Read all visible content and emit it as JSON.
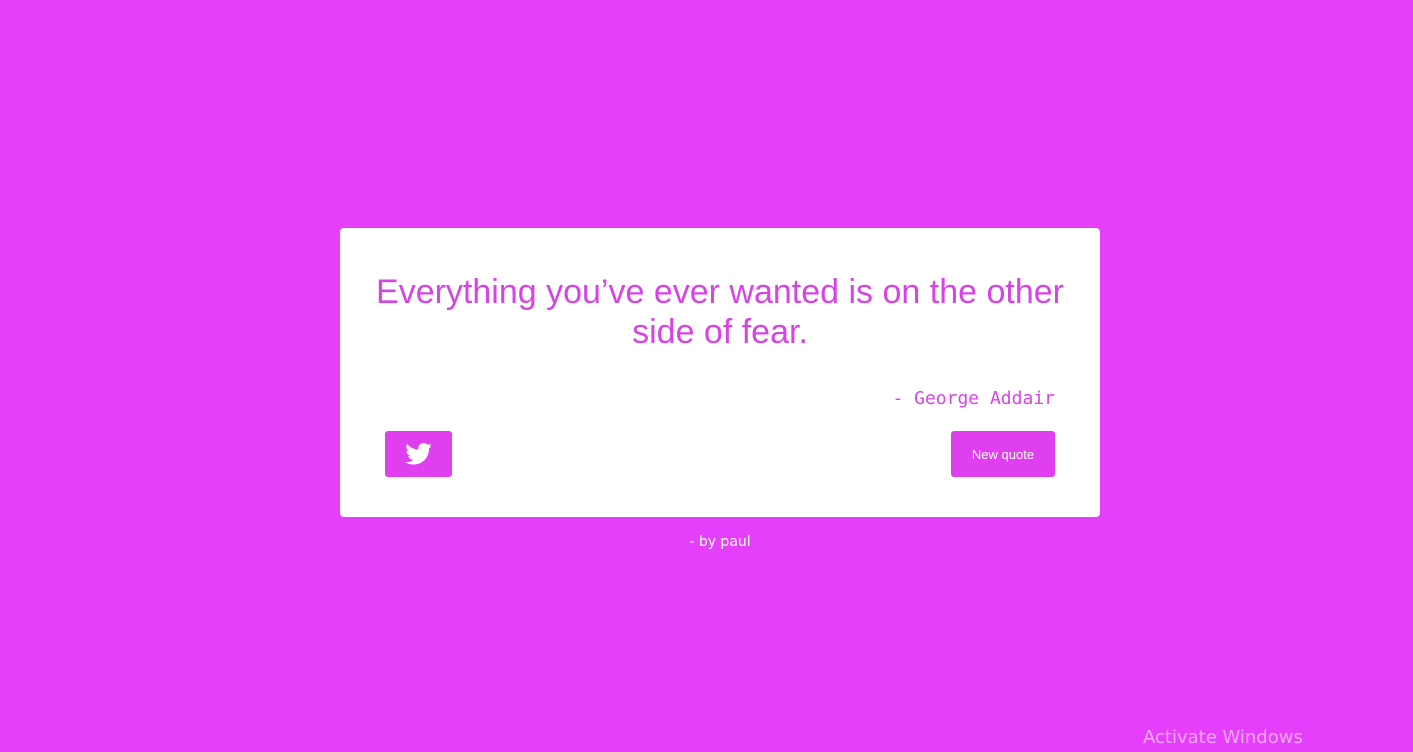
{
  "quote": {
    "text": "Everything you’ve ever wanted is on the other side of fear.",
    "author": "- George Addair"
  },
  "buttons": {
    "tweet_icon": "twitter-bird-icon",
    "new_quote_label": "New quote"
  },
  "footer": {
    "credit": "- by paul"
  },
  "watermark": {
    "text": "Activate Windows"
  },
  "colors": {
    "background": "#e63ffb",
    "accent": "#e03fef",
    "quote_text": "#d744e6",
    "card": "#ffffff"
  }
}
